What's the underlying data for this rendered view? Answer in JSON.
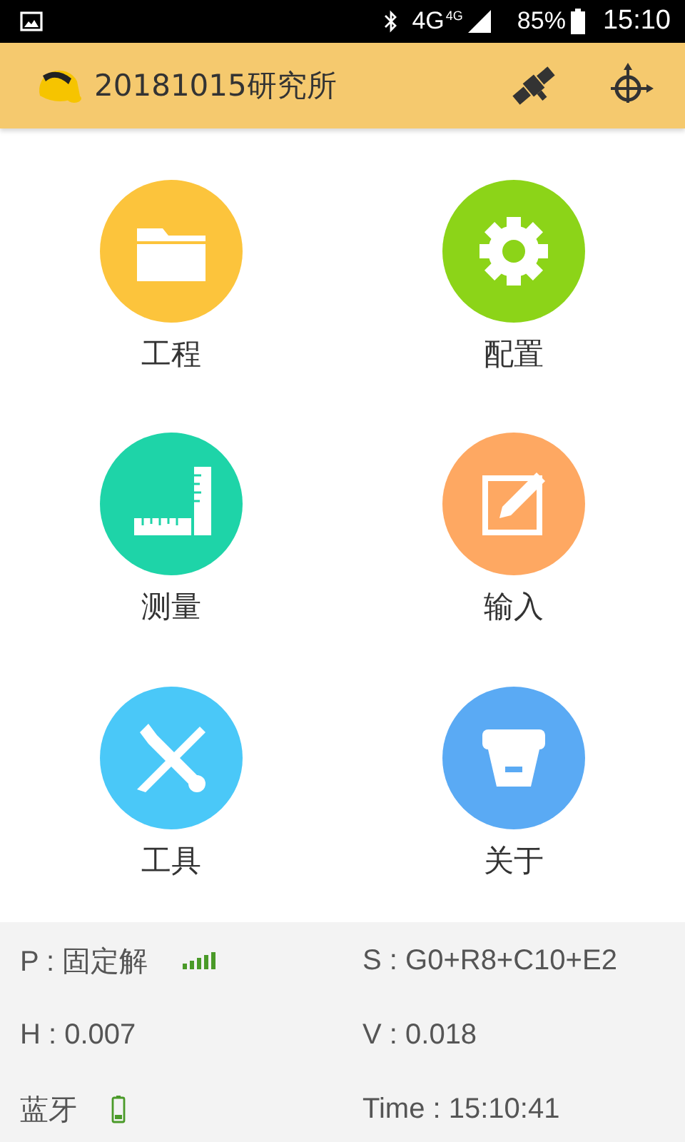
{
  "status_bar": {
    "network": "4G",
    "network_small": "4G",
    "battery": "85%",
    "time": "15:10"
  },
  "app_bar": {
    "title": "20181015研究所"
  },
  "menu": [
    {
      "kind": "folder",
      "label": "工程",
      "color": "#fcc43c"
    },
    {
      "kind": "gear",
      "label": "配置",
      "color": "#8cd418"
    },
    {
      "kind": "ruler",
      "label": "测量",
      "color": "#1ed4a8"
    },
    {
      "kind": "edit",
      "label": "输入",
      "color": "#fea862"
    },
    {
      "kind": "tools",
      "label": "工具",
      "color": "#4ac8f8"
    },
    {
      "kind": "receiver",
      "label": "关于",
      "color": "#5aaaf4"
    }
  ],
  "info": [
    {
      "kind": "signal",
      "label": "P : 固定解"
    },
    {
      "kind": "text",
      "label": "S : G0+R8+C10+E2"
    },
    {
      "kind": "text",
      "label": "H : 0.007"
    },
    {
      "kind": "text",
      "label": "V : 0.018"
    },
    {
      "kind": "battery",
      "label": "蓝牙"
    },
    {
      "kind": "text",
      "label": "Time :  15:10:41"
    }
  ]
}
